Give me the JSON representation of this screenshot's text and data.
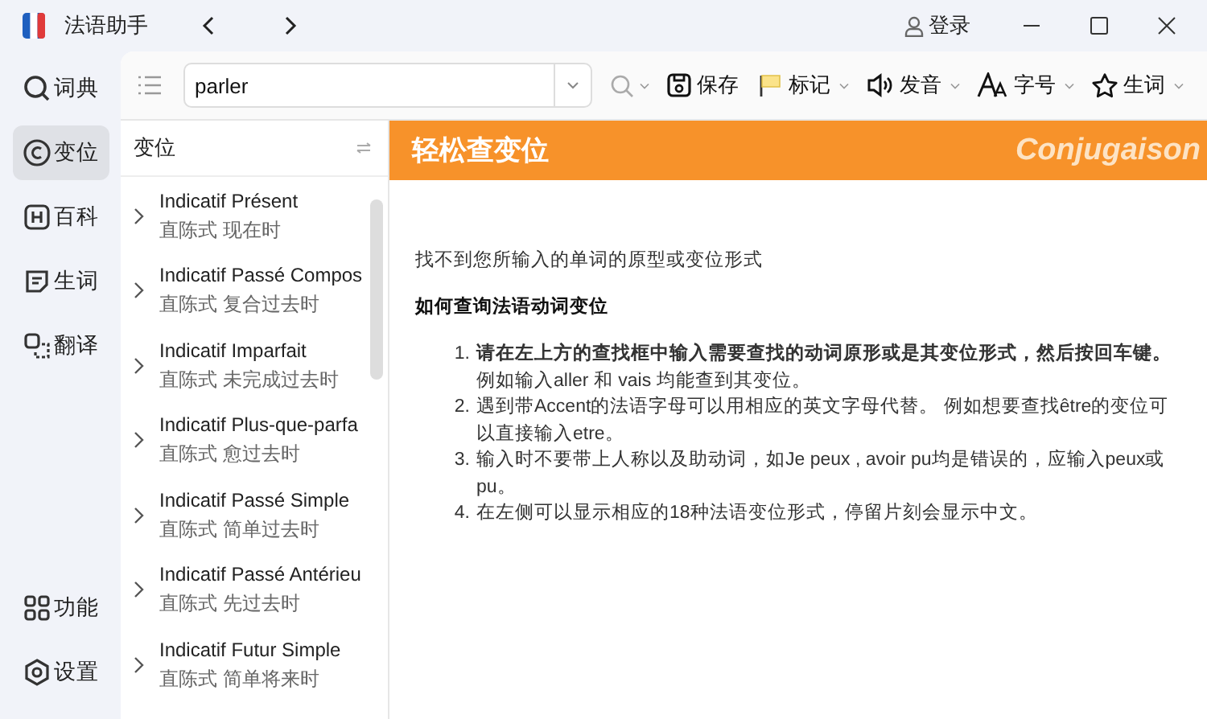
{
  "window": {
    "title": "法语助手",
    "login": "登录"
  },
  "sidebar": {
    "items": [
      {
        "label": "词典",
        "selected": false
      },
      {
        "label": "变位",
        "selected": true
      },
      {
        "label": "百科",
        "selected": false
      },
      {
        "label": "生词",
        "selected": false
      },
      {
        "label": "翻译",
        "selected": false
      }
    ],
    "bottom_items": [
      {
        "label": "功能"
      },
      {
        "label": "设置"
      }
    ]
  },
  "search": {
    "value": "parler"
  },
  "toolbar": [
    {
      "label": "保存",
      "caret": false
    },
    {
      "label": "标记",
      "caret": true
    },
    {
      "label": "发音",
      "caret": true
    },
    {
      "label": "字号",
      "caret": true
    },
    {
      "label": "生词",
      "caret": true
    }
  ],
  "list": {
    "title": "变位",
    "items": [
      {
        "title": "Indicatif Présent",
        "subtitle": "直陈式 现在时"
      },
      {
        "title": "Indicatif Passé Compos",
        "subtitle": "直陈式 复合过去时"
      },
      {
        "title": "Indicatif Imparfait",
        "subtitle": "直陈式 未完成过去时"
      },
      {
        "title": "Indicatif Plus-que-parfa",
        "subtitle": "直陈式 愈过去时"
      },
      {
        "title": "Indicatif Passé Simple",
        "subtitle": "直陈式 简单过去时"
      },
      {
        "title": "Indicatif Passé Antérieu",
        "subtitle": "直陈式 先过去时"
      },
      {
        "title": "Indicatif Futur Simple",
        "subtitle": "直陈式 简单将来时"
      }
    ]
  },
  "banner": {
    "title": "轻松查变位",
    "subtitle": "Conjugaison"
  },
  "content": {
    "message": "找不到您所输入的单词的原型或变位形式",
    "heading": "如何查询法语动词变位",
    "steps": [
      {
        "number": "1.",
        "text": "**请在左上方的查找框中输入需要查找的动词原形或是其变位形式，然后按回车键。**例如输入aller 和 vais 均能查到其变位。"
      },
      {
        "number": "2.",
        "text": "遇到带Accent的法语字母可以用相应的英文字母代替。 例如想要查找être的变位可以直接输入etre。"
      },
      {
        "number": "3.",
        "text": "输入时不要带上人称以及助动词，如Je peux , avoir pu均是错误的，应输入peux或pu。"
      },
      {
        "number": "4.",
        "text": "在左侧可以显示相应的18种法语变位形式，停留片刻会显示中文。"
      }
    ]
  }
}
